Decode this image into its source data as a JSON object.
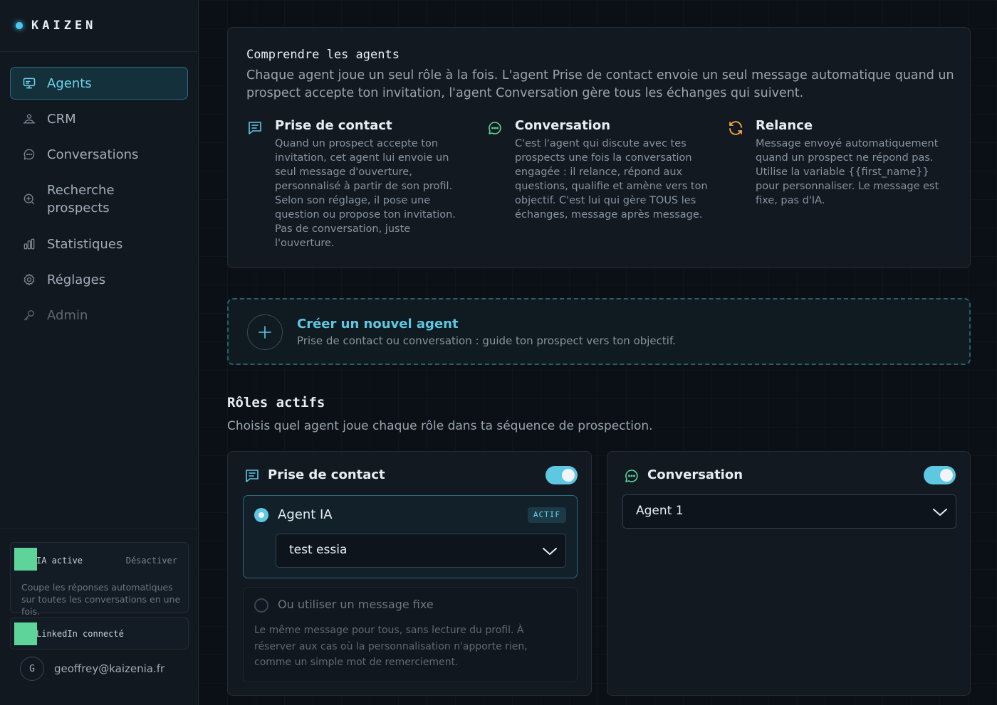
{
  "brand": {
    "name": "KAIZEN"
  },
  "sidebar": {
    "items": [
      {
        "label": "Agents",
        "icon": "monitor-icon",
        "active": true
      },
      {
        "label": "CRM",
        "icon": "users-icon"
      },
      {
        "label": "Conversations",
        "icon": "chat-icon"
      },
      {
        "label": "Recherche prospects",
        "icon": "search-plus-icon"
      },
      {
        "label": "Statistiques",
        "icon": "bar-chart-icon"
      },
      {
        "label": "Réglages",
        "icon": "gear-icon"
      },
      {
        "label": "Admin",
        "icon": "key-icon",
        "disabled": true
      }
    ],
    "ia_status": {
      "title": "IA active",
      "action": "Désactiver",
      "description": "Coupe les réponses automatiques sur toutes les conversations en une fois."
    },
    "linkedin_status": {
      "title": "LinkedIn connecté"
    },
    "user": {
      "initial": "G",
      "email": "geoffrey@kaizenia.fr"
    }
  },
  "understand": {
    "title": "Comprendre les agents",
    "description": "Chaque agent joue un seul rôle à la fois. L'agent Prise de contact envoie un seul message automatique quand un prospect accepte ton invitation, l'agent Conversation gère tous les échanges qui suivent.",
    "columns": [
      {
        "title": "Prise de contact",
        "icon": "message-square-icon",
        "text": "Quand un prospect accepte ton invitation, cet agent lui envoie un seul message d'ouverture, personnalisé à partir de son profil. Selon son réglage, il pose une question ou propose ton invitation. Pas de conversation, juste l'ouverture."
      },
      {
        "title": "Conversation",
        "icon": "chat-bubble-icon",
        "text": "C'est l'agent qui discute avec tes prospects une fois la conversation engagée : il relance, répond aux questions, qualifie et amène vers ton objectif. C'est lui qui gère TOUS les échanges, message après message."
      },
      {
        "title": "Relance",
        "icon": "refresh-icon",
        "text": "Message envoyé automatiquement quand un prospect ne répond pas. Utilise la variable {{first_name}} pour personnaliser. Le message est fixe, pas d'IA."
      }
    ]
  },
  "create_agent": {
    "title": "Créer un nouvel agent",
    "subtitle": "Prise de contact ou conversation : guide ton prospect vers ton objectif."
  },
  "roles": {
    "title": "Rôles actifs",
    "subtitle": "Choisis quel agent joue chaque rôle dans ta séquence de prospection.",
    "contact": {
      "title": "Prise de contact",
      "toggle_on": true,
      "agent_option_label": "Agent IA",
      "badge": "ACTIF",
      "selected_agent": "test essia",
      "fixed_option_label": "Ou utiliser un message fixe",
      "fixed_option_desc": "Le même message pour tous, sans lecture du profil. À réserver aux cas où la personnalisation n'apporte rien, comme un simple mot de remerciement."
    },
    "conversation": {
      "title": "Conversation",
      "toggle_on": true,
      "selected_agent": "Agent 1"
    }
  },
  "colors": {
    "accent": "#5ec8e3",
    "relance_icon": "#f0a848",
    "status_green": "#5fd49a"
  }
}
